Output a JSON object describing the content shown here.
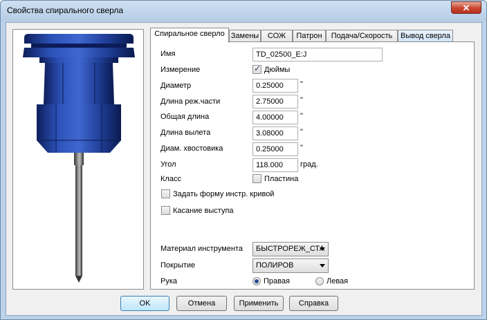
{
  "window": {
    "title": "Свойства спирального сверла",
    "close_glyph": "✕"
  },
  "tabs": [
    {
      "label": "Спиральное сверло",
      "active": true
    },
    {
      "label": "Замены"
    },
    {
      "label": "СОЖ"
    },
    {
      "label": "Патрон"
    },
    {
      "label": "Подача/Скорость"
    },
    {
      "label": "Вывод сверла"
    }
  ],
  "form": {
    "name": {
      "label": "Имя",
      "value": "TD_02500_E:J"
    },
    "measurement": {
      "label": "Измерение",
      "checkbox_label": "Дюймы",
      "checked": true
    },
    "diameter": {
      "label": "Диаметр",
      "value": "0.25000",
      "unit": "\""
    },
    "flute_length": {
      "label": "Длина реж.части",
      "value": "2.75000",
      "unit": "\""
    },
    "overall_length": {
      "label": "Общая длина",
      "value": "4.00000",
      "unit": "\""
    },
    "overhang_length": {
      "label": "Длина вылета",
      "value": "3.08000",
      "unit": "\""
    },
    "shank_diameter": {
      "label": "Диам. хвостовика",
      "value": "0.25000",
      "unit": "\""
    },
    "angle": {
      "label": "Угол",
      "value": "118.000",
      "unit": "град."
    },
    "class": {
      "label": "Класс",
      "checkbox_label": "Пластина",
      "checked": false
    },
    "curve_shape": {
      "label": "Задать форму инстр. кривой",
      "checked": false
    },
    "shoulder_touch": {
      "label": "Касание выступа",
      "checked": false
    },
    "tool_material": {
      "label": "Материал инструмента",
      "value": "БЫСТРОРЕЖ_СТА"
    },
    "coating": {
      "label": "Покрытие",
      "value": "ПОЛИРОВ"
    },
    "hand": {
      "label": "Рука",
      "right": "Правая",
      "left": "Левая",
      "selected": "right"
    }
  },
  "buttons": {
    "ok": "OK",
    "cancel": "Отмена",
    "apply": "Применить",
    "help": "Справка"
  },
  "colors": {
    "holder_blue": "#1f3f97",
    "titlebar": "#bcd2ea",
    "panel_bg": "#f0f0f0"
  }
}
